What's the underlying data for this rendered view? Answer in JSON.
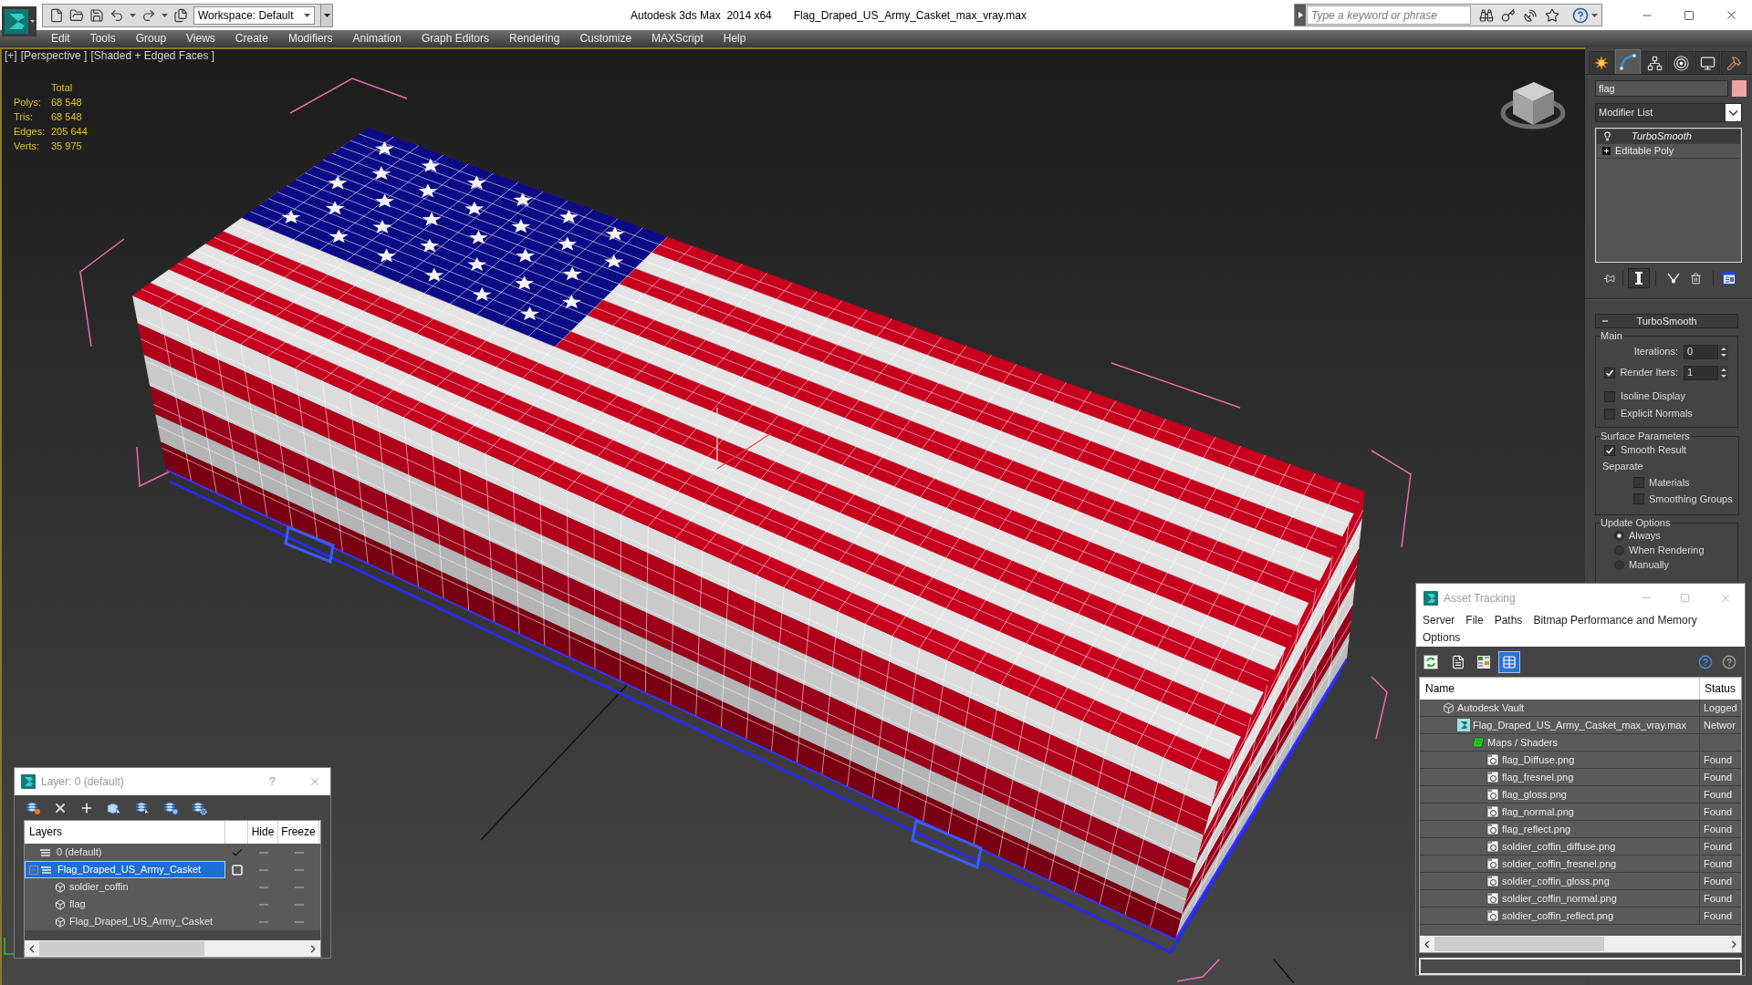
{
  "window": {
    "app_title": "Autodesk 3ds Max  2014 x64",
    "file_name": "Flag_Draped_US_Army_Casket_max_vray.max",
    "workspace": "Workspace: Default",
    "search": {
      "placeholder": "Type a keyword or phrase"
    }
  },
  "menu": [
    "Edit",
    "Tools",
    "Group",
    "Views",
    "Create",
    "Modifiers",
    "Animation",
    "Graph Editors",
    "Rendering",
    "Customize",
    "MAXScript",
    "Help"
  ],
  "viewport": {
    "labels": [
      "[+]",
      "[Perspective ]",
      "[Shaded + Edged Faces ]"
    ],
    "stats": {
      "header": "Total",
      "rows": [
        {
          "label": "Polys:",
          "value": "68 548"
        },
        {
          "label": "Tris:",
          "value": "68 548"
        },
        {
          "label": "Edges:",
          "value": "205 644"
        },
        {
          "label": "Verts:",
          "value": "35 975"
        }
      ]
    }
  },
  "command_panel": {
    "tabs": [
      {
        "selected": false
      },
      {
        "selected": true
      },
      {
        "selected": false
      },
      {
        "selected": false
      },
      {
        "selected": false
      },
      {
        "selected": false
      }
    ],
    "object_name": {
      "value": "flag",
      "color": "#eea3a3"
    },
    "modifier_list": "Modifier List",
    "stack": [
      {
        "label": "TurboSmooth",
        "kind": "modifier",
        "selected": true
      },
      {
        "label": "Editable Poly",
        "kind": "base",
        "selected": false,
        "expanded": false
      }
    ],
    "stack_toggles": [
      {
        "on": false
      },
      {
        "on": true
      }
    ],
    "rollout": {
      "title": "TurboSmooth",
      "expanded": true,
      "groups": [
        {
          "title": "Main",
          "controls": [
            {
              "kind": "spinner",
              "label": "Iterations:",
              "value": "0"
            },
            {
              "kind": "check_spinner",
              "label": "Render Iters:",
              "checked": true,
              "value": "1"
            },
            {
              "kind": "checkbox",
              "label": "Isoline Display",
              "checked": false
            },
            {
              "kind": "checkbox",
              "label": "Explicit Normals",
              "checked": false
            }
          ]
        },
        {
          "title": "Surface Parameters",
          "controls": [
            {
              "kind": "checkbox",
              "label": "Smooth Result",
              "checked": true
            },
            {
              "kind": "label",
              "label": "Separate"
            },
            {
              "kind": "sub_checkbox",
              "label": "Materials",
              "checked": false
            },
            {
              "kind": "sub_checkbox",
              "label": "Smoothing Groups",
              "checked": false
            }
          ]
        },
        {
          "title": "Update Options",
          "controls": [
            {
              "kind": "radio",
              "label": "Always",
              "selected": true
            },
            {
              "kind": "radio",
              "label": "When Rendering",
              "selected": false
            },
            {
              "kind": "radio",
              "label": "Manually",
              "selected": false
            }
          ]
        }
      ]
    }
  },
  "layer_dialog": {
    "title": "Layer: 0 (default)",
    "help": "?",
    "columns": [
      "Layers",
      "Hide",
      "Freeze"
    ],
    "rows": [
      {
        "name": "0 (default)",
        "kind": "layer",
        "selected": false,
        "current": true,
        "hidden": false,
        "frozen": false
      },
      {
        "name": "Flag_Draped_US_Army_Casket",
        "kind": "layer",
        "selected": true,
        "current": false,
        "expanded": true,
        "hidden": false,
        "frozen": false,
        "children": [
          {
            "name": "soldier_coffin",
            "kind": "object",
            "selected": false,
            "hidden": false,
            "frozen": false
          },
          {
            "name": "flag",
            "kind": "object",
            "selected": false,
            "hidden": false,
            "frozen": false
          },
          {
            "name": "Flag_Draped_US_Army_Casket",
            "kind": "object",
            "selected": false,
            "hidden": false,
            "frozen": false
          }
        ]
      }
    ]
  },
  "asset_tracking": {
    "title": "Asset Tracking",
    "menu": [
      "Server",
      "File",
      "Paths",
      "Bitmap Performance and Memory",
      "Options"
    ],
    "view_modes": [
      {
        "selected": false
      },
      {
        "selected": false
      },
      {
        "selected": true
      }
    ],
    "columns": [
      "Name",
      "Status"
    ],
    "rows": [
      {
        "name": "Autodesk Vault",
        "kind": "vault",
        "status": "Logged",
        "selected": false,
        "children": [
          {
            "name": "Flag_Draped_US_Army_Casket_max_vray.max",
            "kind": "scene",
            "status": "Networ",
            "selected": false,
            "children": [
              {
                "name": "Maps / Shaders",
                "kind": "folder",
                "selected": false,
                "children": [
                  {
                    "name": "flag_Diffuse.png",
                    "kind": "bitmap",
                    "status": "Found",
                    "selected": false
                  },
                  {
                    "name": "flag_fresnel.png",
                    "kind": "bitmap",
                    "status": "Found",
                    "selected": false
                  },
                  {
                    "name": "flag_gloss.png",
                    "kind": "bitmap",
                    "status": "Found",
                    "selected": false
                  },
                  {
                    "name": "flag_normal.png",
                    "kind": "bitmap",
                    "status": "Found",
                    "selected": false
                  },
                  {
                    "name": "flag_reflect.png",
                    "kind": "bitmap",
                    "status": "Found",
                    "selected": false
                  },
                  {
                    "name": "soldier_coffin_diffuse.png",
                    "kind": "bitmap",
                    "status": "Found",
                    "selected": false
                  },
                  {
                    "name": "soldier_coffin_fresnel.png",
                    "kind": "bitmap",
                    "status": "Found",
                    "selected": false
                  },
                  {
                    "name": "soldier_coffin_gloss.png",
                    "kind": "bitmap",
                    "status": "Found",
                    "selected": false
                  },
                  {
                    "name": "soldier_coffin_normal.png",
                    "kind": "bitmap",
                    "status": "Found",
                    "selected": false
                  },
                  {
                    "name": "soldier_coffin_reflect.png",
                    "kind": "bitmap",
                    "status": "Found",
                    "selected": false
                  }
                ]
              }
            ]
          }
        ]
      }
    ]
  }
}
